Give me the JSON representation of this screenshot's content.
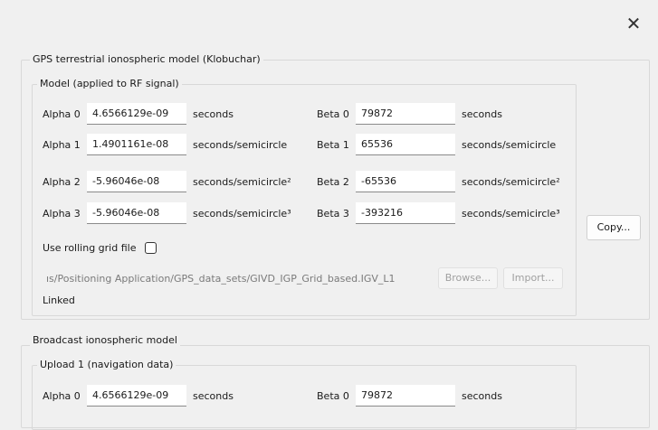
{
  "window": {
    "close_glyph": "✕",
    "close_icon": "close-icon"
  },
  "klobuchar": {
    "title": "GPS terrestrial ionospheric model (Klobuchar)",
    "model_title": "Model (applied to RF signal)",
    "alpha": [
      {
        "label": "Alpha 0",
        "value": "4.6566129e-09",
        "unit": "seconds"
      },
      {
        "label": "Alpha 1",
        "value": "1.4901161e-08",
        "unit": "seconds/semicircle"
      },
      {
        "label": "Alpha 2",
        "value": "-5.96046e-08",
        "unit": "seconds/semicircle²"
      },
      {
        "label": "Alpha 3",
        "value": "-5.96046e-08",
        "unit": "seconds/semicircle³"
      }
    ],
    "beta": [
      {
        "label": "Beta 0",
        "value": "79872",
        "unit": "seconds"
      },
      {
        "label": "Beta 1",
        "value": "65536",
        "unit": "seconds/semicircle"
      },
      {
        "label": "Beta 2",
        "value": "-65536",
        "unit": "seconds/semicircle²"
      },
      {
        "label": "Beta 3",
        "value": "-393216",
        "unit": "seconds/semicircle³"
      }
    ],
    "rolling_grid_label": "Use rolling grid file",
    "rolling_grid_checked": false,
    "grid_path": "ıs/Positioning Application/GPS_data_sets/GIVD_IGP_Grid_based.IGV_L1",
    "browse_label": "Browse...",
    "import_label": "Import...",
    "linked_label": "Linked",
    "copy_label": "Copy..."
  },
  "broadcast": {
    "title": "Broadcast ionospheric model",
    "upload_title": "Upload 1 (navigation data)",
    "alpha0": {
      "label": "Alpha 0",
      "value": "4.6566129e-09",
      "unit": "seconds"
    },
    "beta0": {
      "label": "Beta 0",
      "value": "79872",
      "unit": "seconds"
    }
  }
}
